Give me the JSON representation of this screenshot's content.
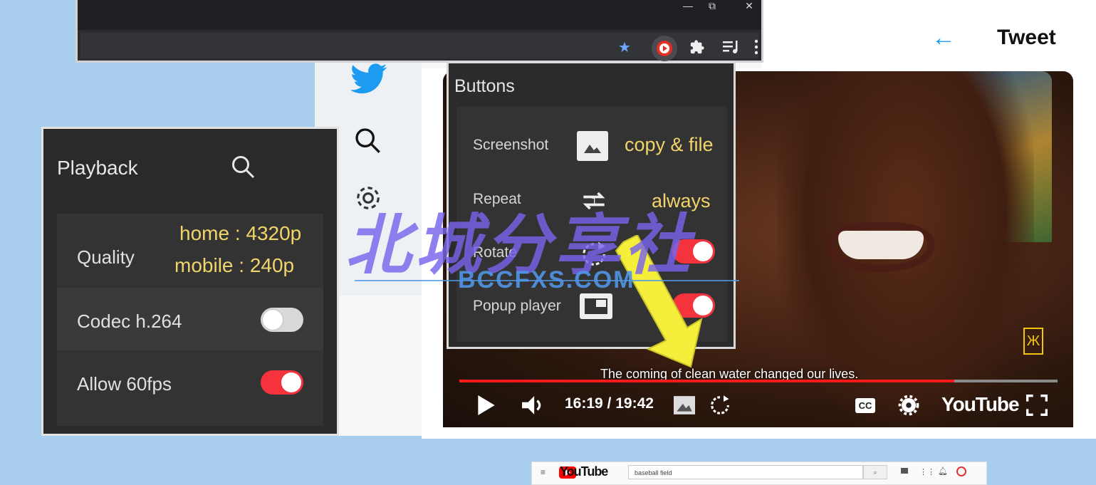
{
  "browser": {
    "window_controls": [
      "—",
      "⧉",
      "✕"
    ],
    "toolbar_icons": [
      "star-icon",
      "youtube-extension-icon",
      "puzzle-icon",
      "playlist-icon",
      "kebab-menu-icon"
    ]
  },
  "twitter": {
    "tweet_title": "Tweet",
    "back_arrow": "←",
    "brand_color": "#1d9bf0"
  },
  "buttons_panel": {
    "title": "Buttons",
    "rows": [
      {
        "label": "Screenshot",
        "value": "copy & file",
        "icon": "image-icon"
      },
      {
        "label": "Repeat",
        "value": "always",
        "icon": "repeat-one-icon"
      },
      {
        "label": "Rotate",
        "toggle": "on",
        "icon": "rotate-icon"
      },
      {
        "label": "Popup player",
        "toggle": "on",
        "icon": "popup-player-icon"
      }
    ]
  },
  "playback_panel": {
    "title": "Playback",
    "quality_label": "Quality",
    "quality_home": "home : 4320p",
    "quality_mobile": "mobile : 240p",
    "codec_label": "Codec h.264",
    "codec_toggle": "off",
    "fps_label": "Allow 60fps",
    "fps_toggle": "on"
  },
  "video": {
    "subtitle": "The coming of clean water changed our lives.",
    "time": "16:19 / 19:42",
    "progress": 0.827,
    "brand": "YouTube",
    "cc_label": "CC",
    "yellow_badge": "Ж"
  },
  "watermark": {
    "main": "北城分享社",
    "sub": "BCCFXS.COM"
  },
  "youtube_bar": {
    "logo": "YouTube",
    "search_value": "baseball field"
  },
  "colors": {
    "accent_red": "#f4333d",
    "value_yellow": "#f1d46a",
    "panel_bg": "#2a2a2a"
  }
}
